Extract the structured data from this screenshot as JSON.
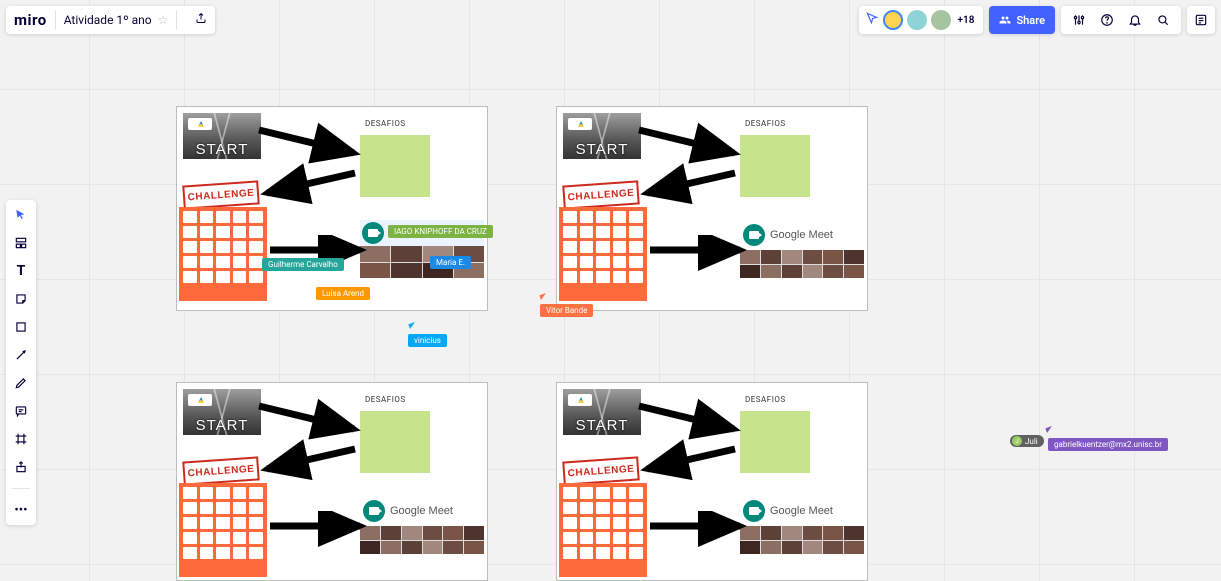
{
  "header": {
    "logo": "miro",
    "board_title": "Atividade 1º ano"
  },
  "presence": {
    "overflow_count": "+18"
  },
  "share": {
    "label": "Share"
  },
  "frames": {
    "start_text": "START",
    "sticky_label": "DESAFIOS",
    "challenge_text": "CHALLENGE",
    "meet_title": "Google Meet",
    "meet_title_faint": "Google Meet"
  },
  "cursors": {
    "iago": "IAGO KNIPHOFF DA CRUZ",
    "maria": "Maria E.",
    "guilherme": "Guilherme Carvalho",
    "luisa": "Luisa Arend",
    "vinicius": "vinicius",
    "vitor": "Vitor Bande",
    "juli": "Juli",
    "gabriel": "gabrielkuentzer@mx2.unisc.br"
  }
}
